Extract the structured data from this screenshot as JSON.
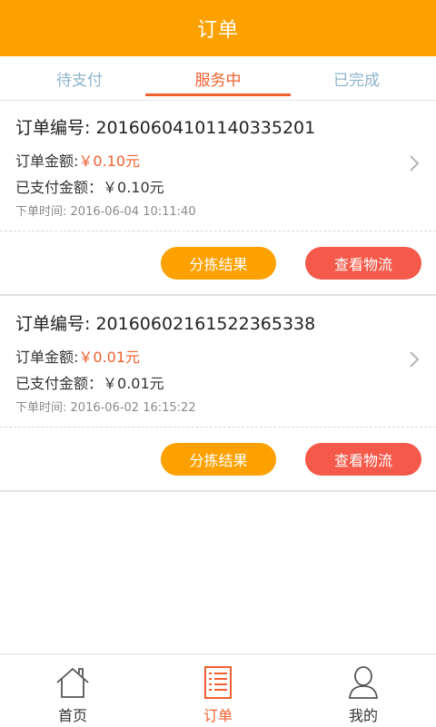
{
  "header": {
    "title": "订单"
  },
  "tabs": [
    {
      "label": "待支付",
      "active": false
    },
    {
      "label": "服务中",
      "active": true
    },
    {
      "label": "已完成",
      "active": false
    }
  ],
  "orders": [
    {
      "order_no_label": "订单编号:",
      "order_no": "20160604101140335201",
      "amount_label": "订单金额:",
      "amount": "￥0.10元",
      "paid_label": "已支付金额：",
      "paid": "￥0.10元",
      "time_label": "下单时间:",
      "time": "2016-06-04 10:11:40",
      "sort_button": "分拣结果",
      "logistics_button": "查看物流"
    },
    {
      "order_no_label": "订单编号:",
      "order_no": "20160602161522365338",
      "amount_label": "订单金额:",
      "amount": "￥0.01元",
      "paid_label": "已支付金额：",
      "paid": "￥0.01元",
      "time_label": "下单时间:",
      "time": "2016-06-02 16:15:22",
      "sort_button": "分拣结果",
      "logistics_button": "查看物流"
    }
  ],
  "bottom_nav": [
    {
      "label": "首页",
      "icon": "home-icon",
      "active": false
    },
    {
      "label": "订单",
      "icon": "order-list-icon",
      "active": true
    },
    {
      "label": "我的",
      "icon": "user-icon",
      "active": false
    }
  ],
  "colors": {
    "header_bg": "#fda100",
    "accent_red": "#f0602f",
    "sort_button_bg": "#fda100",
    "logistics_button_bg": "#f4594a",
    "inactive_tab": "#8fb4cc"
  }
}
